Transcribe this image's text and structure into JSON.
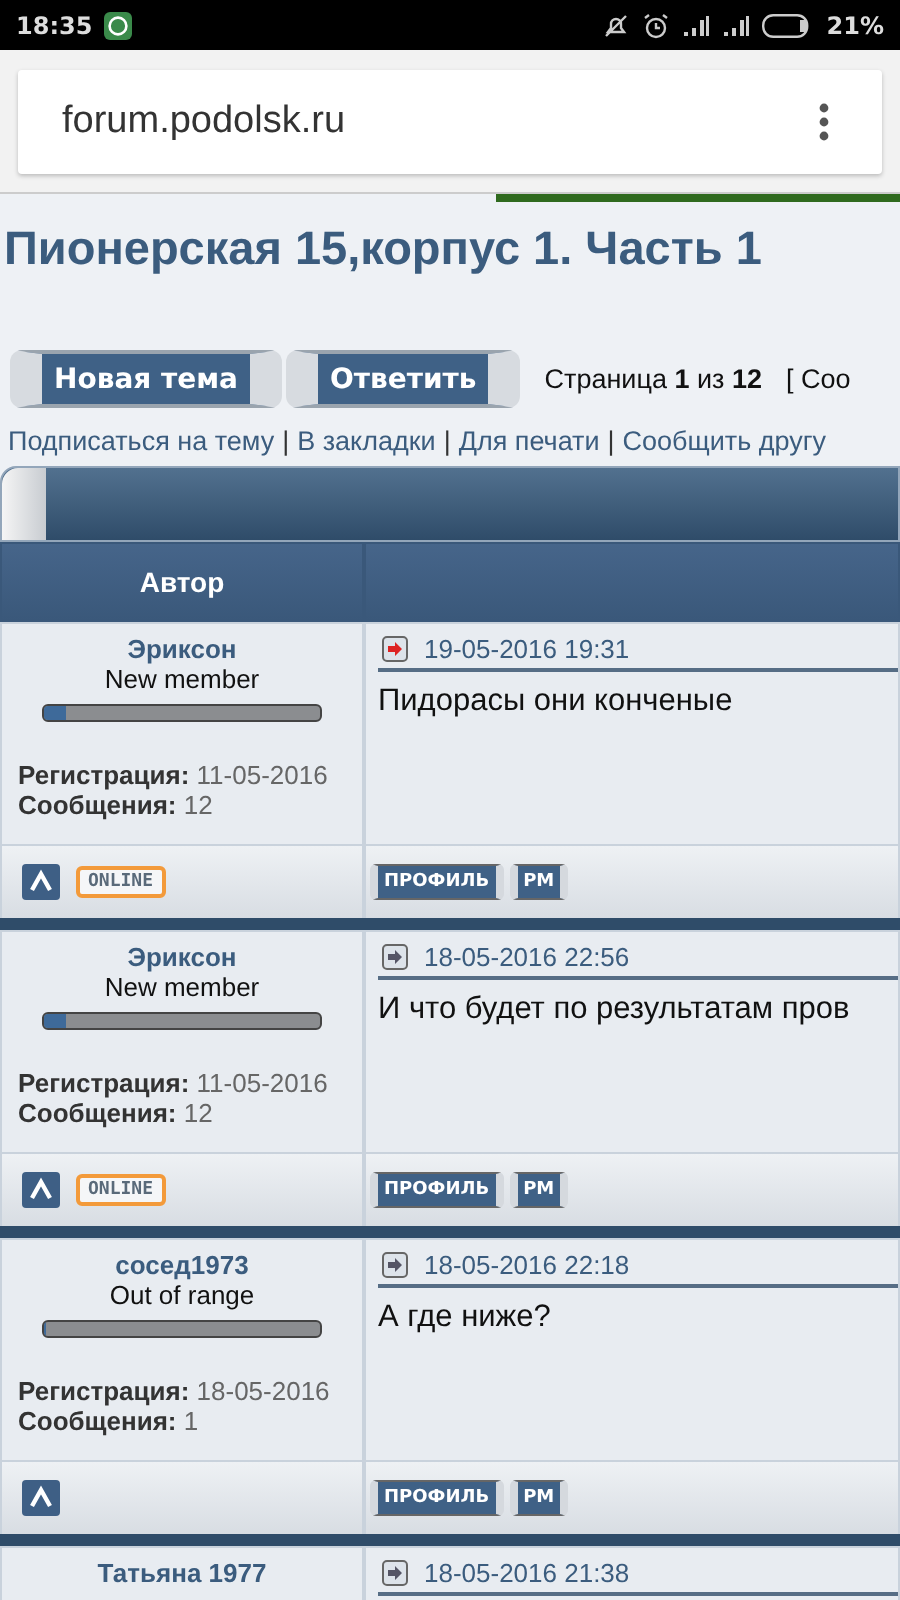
{
  "status_bar": {
    "time": "18:35",
    "battery": "21%"
  },
  "browser": {
    "url": "forum.podolsk.ru"
  },
  "topic": {
    "title": "Пионерская 15,корпус 1. Часть 1"
  },
  "toolbar": {
    "buttons": [
      "Новая тема",
      "Ответить"
    ],
    "pagination": "Страница **1** из **12**",
    "pagination_extra": "[ Соо"
  },
  "link_separator": "|",
  "links": [
    "Подписаться на тему",
    "В закладки",
    "Для печати",
    "Сообщить другу"
  ],
  "table": {
    "columns": [
      "Автор"
    ]
  },
  "posts": [
    {
      "author": "Эриксон",
      "rank": "New member",
      "level": 0.08,
      "reg_label": "Регистрация:",
      "reg_date": "11-05-2016",
      "count_label": "Сообщения:",
      "count": "12",
      "unread": true,
      "date": "19-05-2016 19:31",
      "text": "Пидорасы они конченые",
      "online": true,
      "online_label": "ONLINE",
      "buttons": [
        "ПРОФИЛЬ",
        "PM"
      ]
    },
    {
      "author": "Эриксон",
      "rank": "New member",
      "level": 0.08,
      "reg_label": "Регистрация:",
      "reg_date": "11-05-2016",
      "count_label": "Сообщения:",
      "count": "12",
      "unread": false,
      "date": "18-05-2016 22:56",
      "text": "И что будет по результатам пров",
      "online": true,
      "online_label": "ONLINE",
      "buttons": [
        "ПРОФИЛЬ",
        "PM"
      ]
    },
    {
      "author": "сосед1973",
      "rank": "Out of range",
      "level": 0,
      "reg_label": "Регистрация:",
      "reg_date": "18-05-2016",
      "count_label": "Сообщения:",
      "count": "1",
      "unread": false,
      "date": "18-05-2016 22:18",
      "text": "А где ниже?",
      "online": false,
      "buttons": [
        "ПРОФИЛЬ",
        "PM"
      ]
    },
    {
      "author": "Татьяна 1977",
      "unread": false,
      "date": "18-05-2016 21:38"
    }
  ]
}
